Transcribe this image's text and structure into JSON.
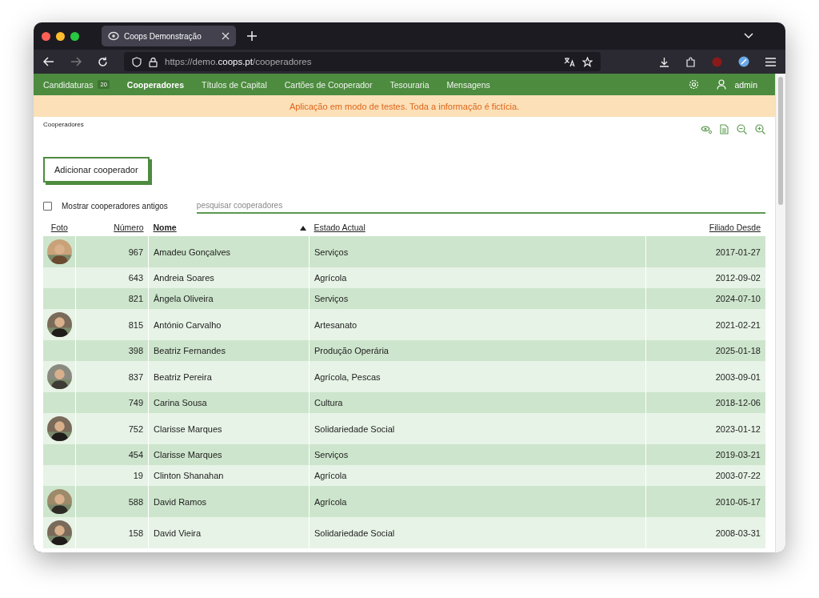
{
  "browser": {
    "tab_title": "Coops Demonstração",
    "url_prefix": "https://demo.",
    "url_domain": "coops.pt",
    "url_path": "/cooperadores"
  },
  "nav": {
    "items": [
      {
        "label": "Candidaturas",
        "badge": "20",
        "selected": false
      },
      {
        "label": "Cooperadores",
        "selected": true
      },
      {
        "label": "Títulos de Capital",
        "selected": false
      },
      {
        "label": "Cartões de Cooperador",
        "selected": false
      },
      {
        "label": "Tesouraria",
        "selected": false
      },
      {
        "label": "Mensagens",
        "selected": false
      }
    ],
    "user": "admin"
  },
  "banner": "Aplicação em modo de testes. Toda a informação é fictícia.",
  "breadcrumb": "Cooperadores",
  "add_button": "Adicionar cooperador",
  "filter": {
    "label": "Mostrar cooperadores antigos",
    "checked": false
  },
  "search": {
    "placeholder": "pesquisar cooperadores"
  },
  "table": {
    "columns": [
      {
        "label": "Foto",
        "sorted": false
      },
      {
        "label": "Número",
        "sorted": false
      },
      {
        "label": "Nome",
        "sorted": true
      },
      {
        "label": "Estado Actual",
        "sorted": false
      },
      {
        "label": "Filiado Desde",
        "sorted": false
      }
    ],
    "rows": [
      {
        "photo": true,
        "number": "967",
        "name": "Amadeu Gonçalves",
        "status": "Serviços",
        "since": "2017-01-27"
      },
      {
        "photo": false,
        "number": "643",
        "name": "Andreia Soares",
        "status": "Agrícola",
        "since": "2012-09-02"
      },
      {
        "photo": false,
        "number": "821",
        "name": "Ângela Oliveira",
        "status": "Serviços",
        "since": "2024-07-10"
      },
      {
        "photo": true,
        "number": "815",
        "name": "António Carvalho",
        "status": "Artesanato",
        "since": "2021-02-21"
      },
      {
        "photo": false,
        "number": "398",
        "name": "Beatriz Fernandes",
        "status": "Produção Operária",
        "since": "2025-01-18"
      },
      {
        "photo": true,
        "number": "837",
        "name": "Beatriz Pereira",
        "status": "Agrícola, Pescas",
        "since": "2003-09-01"
      },
      {
        "photo": false,
        "number": "749",
        "name": "Carina Sousa",
        "status": "Cultura",
        "since": "2018-12-06"
      },
      {
        "photo": true,
        "number": "752",
        "name": "Clarisse Marques",
        "status": "Solidariedade Social",
        "since": "2023-01-12"
      },
      {
        "photo": false,
        "number": "454",
        "name": "Clarisse Marques",
        "status": "Serviços",
        "since": "2019-03-21"
      },
      {
        "photo": false,
        "number": "19",
        "name": "Clinton Shanahan",
        "status": "Agrícola",
        "since": "2003-07-22"
      },
      {
        "photo": true,
        "number": "588",
        "name": "David Ramos",
        "status": "Agrícola",
        "since": "2010-05-17"
      },
      {
        "photo": true,
        "number": "158",
        "name": "David Vieira",
        "status": "Solidariedade Social",
        "since": "2008-03-31"
      }
    ]
  }
}
